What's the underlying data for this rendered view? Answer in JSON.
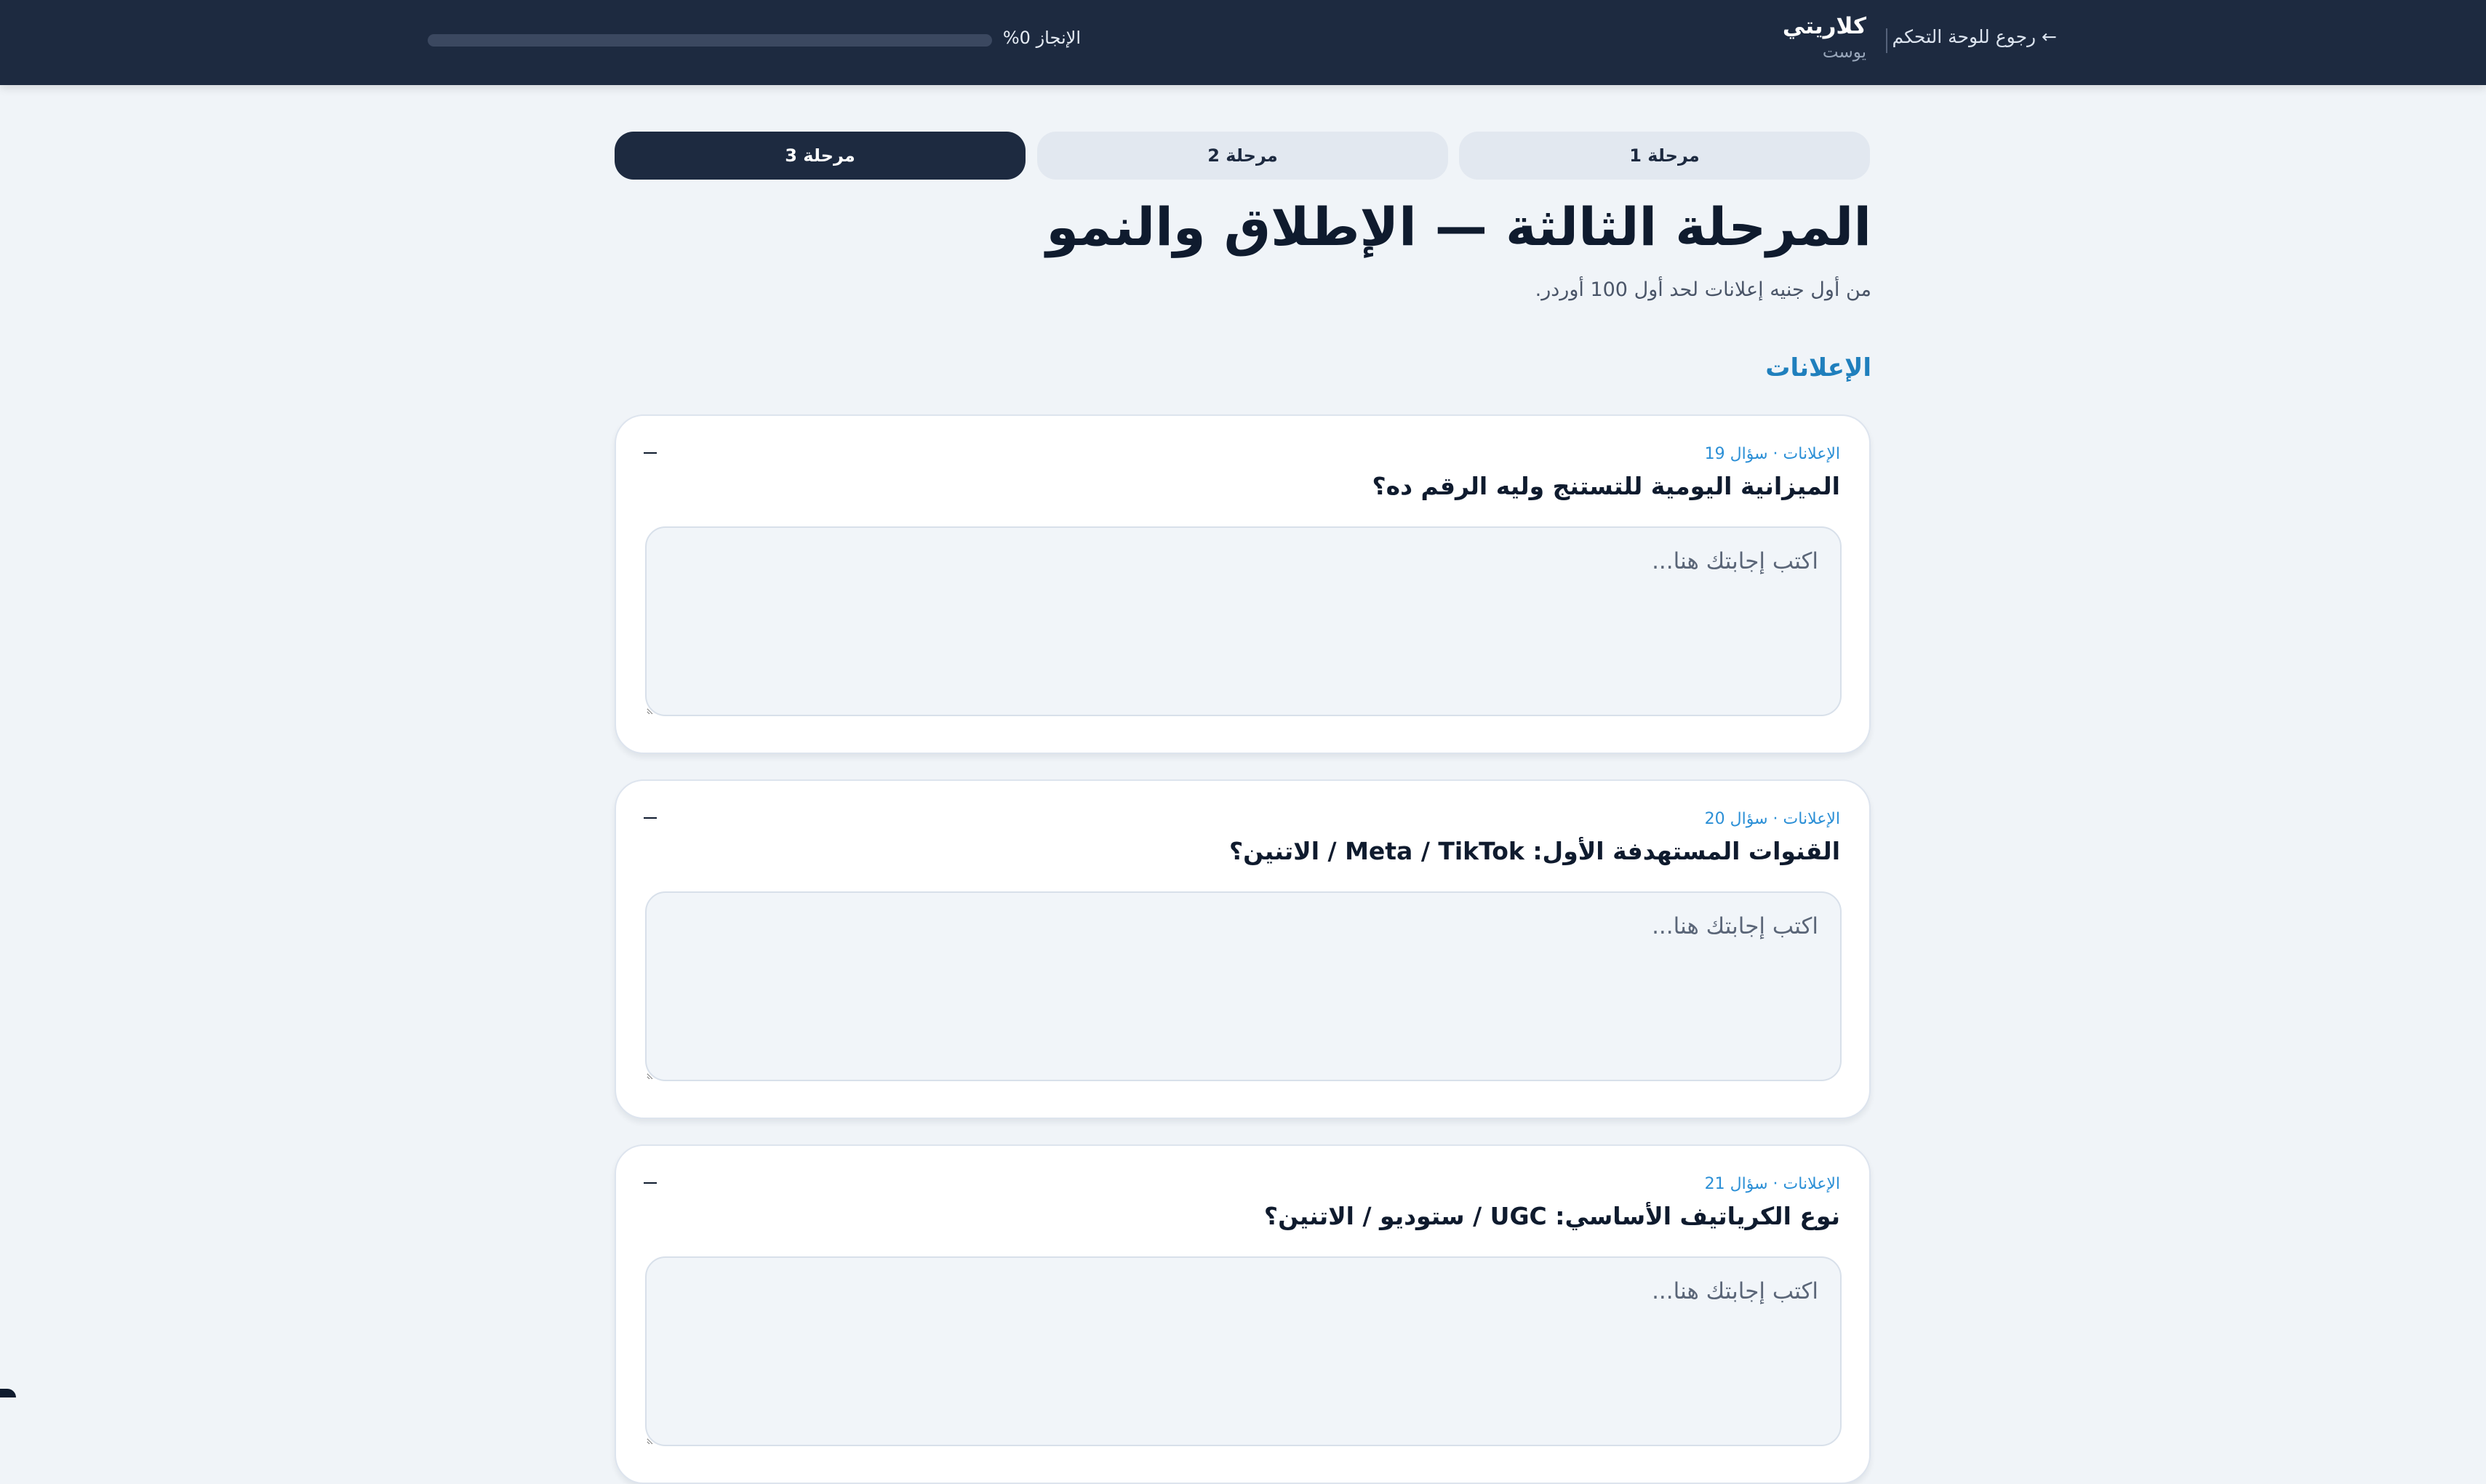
{
  "header": {
    "back_label": "← رجوع للوحة التحكم",
    "brand_name": "كلاريتي",
    "brand_sub": "يوست",
    "progress_label": "الإنجاز 0%",
    "progress_value": 0
  },
  "stages": {
    "tabs": [
      {
        "label": "مرحلة 1",
        "active": false
      },
      {
        "label": "مرحلة 2",
        "active": false
      },
      {
        "label": "مرحلة 3",
        "active": true
      }
    ]
  },
  "page": {
    "title": "المرحلة الثالثة — الإطلاق والنمو",
    "subtitle": "من أول جنيه إعلانات لحد أول 100 أوردر.",
    "section_title": "الإعلانات"
  },
  "questions": [
    {
      "meta": "الإعلانات · سؤال 19",
      "text": "الميزانية اليومية للتستنج وليه الرقم ده؟",
      "placeholder": "اكتب إجابتك هنا...",
      "value": ""
    },
    {
      "meta": "الإعلانات · سؤال 20",
      "text": "القنوات المستهدفة الأول: Meta / TikTok / الاتنين؟",
      "placeholder": "اكتب إجابتك هنا...",
      "value": ""
    },
    {
      "meta": "الإعلانات · سؤال 21",
      "text": "نوع الكرياتيف الأساسي: UGC / ستوديو / الاتنين؟",
      "placeholder": "اكتب إجابتك هنا...",
      "value": ""
    }
  ],
  "colors": {
    "header_bg": "#1d2a40",
    "page_bg": "#f0f4f8",
    "accent": "#2b8fd6",
    "section_title": "#1f7fbd"
  },
  "icons": {
    "collapse": "minus-icon",
    "back": "arrow-left-icon"
  }
}
